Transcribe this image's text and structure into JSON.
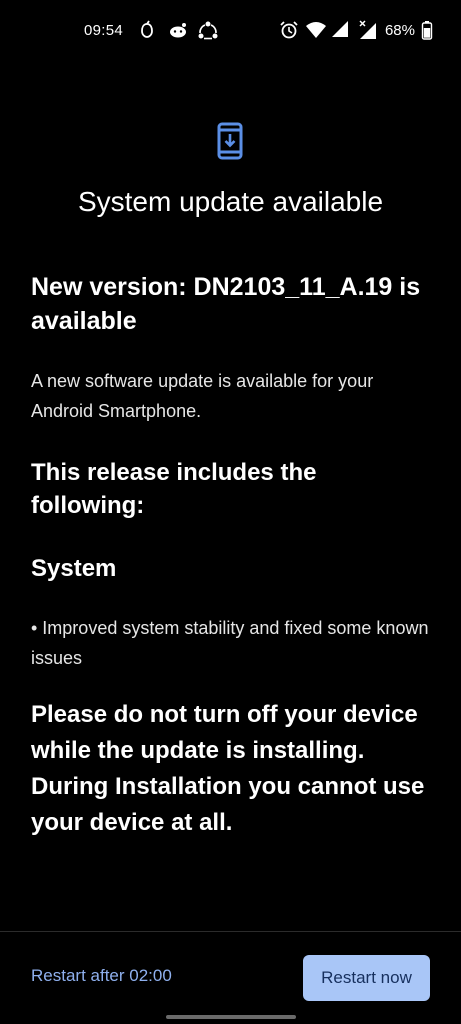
{
  "status_bar": {
    "time": "09:54",
    "battery_percent": "68%",
    "icons_left": [
      "app-notification-icon",
      "reddit-icon",
      "sync-icon"
    ],
    "icons_right": [
      "alarm-icon",
      "wifi-icon",
      "signal-icon",
      "signal-no-data-icon",
      "battery-icon"
    ]
  },
  "header": {
    "icon": "system-update-icon",
    "title": "System update available"
  },
  "content": {
    "version_heading": "New version: DN2103_11_A.19 is available",
    "description": "A new software update is available for your Android Smartphone.",
    "release_heading": "This release includes the following:",
    "section_title": "System",
    "bullet": "• Improved system stability and fixed some known issues",
    "warning": "Please do not turn off your device while the update is installing. During Installation you cannot use your device at all."
  },
  "actions": {
    "restart_later_label": "Restart after 02:00",
    "restart_now_label": "Restart now"
  },
  "colors": {
    "background": "#000000",
    "accent_icon": "#5b8fe6",
    "link_text": "#8fb0ee",
    "primary_button": "#a9c6f7",
    "primary_button_text": "#17305e"
  }
}
